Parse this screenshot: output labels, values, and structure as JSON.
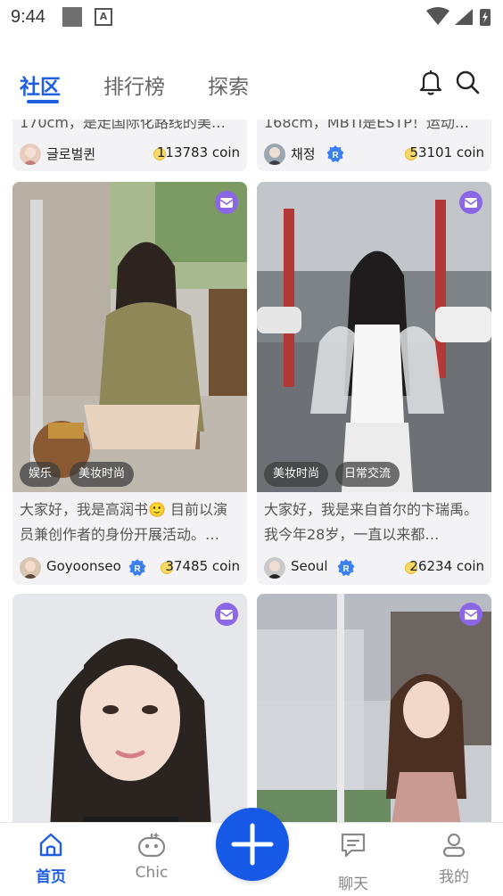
{
  "status_bar": {
    "time": "9:44",
    "notification_letter": "A"
  },
  "header": {
    "tabs": [
      {
        "label": "社区",
        "active": true
      },
      {
        "label": "排行榜",
        "active": false
      },
      {
        "label": "探索",
        "active": false
      }
    ],
    "icons": [
      "bell-icon",
      "search-icon"
    ]
  },
  "feed": {
    "top_partial_cards": [
      {
        "text": "170cm，是走国际化路线的美…",
        "author": "글로벌퀸",
        "verified": false,
        "coins": "113783 coin"
      },
      {
        "text": "168cm，MBTI是ESTP！运动…",
        "author": "채정",
        "verified": true,
        "coins": "53101 coin"
      }
    ],
    "cards": [
      {
        "tags": [
          "娱乐",
          "美妆时尚"
        ],
        "text": "大家好，我是高润书🙂 目前以演员兼创作者的身份开展活动。…",
        "author": "Goyoonseo",
        "verified": true,
        "coins": "37485 coin"
      },
      {
        "tags": [
          "美妆时尚",
          "日常交流"
        ],
        "text": "大家好，我是来自首尔的卞瑞禹。 我今年28岁，一直以来都…",
        "author": "Seoul",
        "verified": true,
        "coins": "26234 coin"
      }
    ]
  },
  "bottom_nav": {
    "items": [
      {
        "label": "首页",
        "icon": "home-icon",
        "active": true
      },
      {
        "label": "Chic",
        "icon": "robot-icon",
        "active": false
      },
      {
        "label": "聊天",
        "icon": "chat-icon",
        "active": false
      },
      {
        "label": "我的",
        "icon": "profile-icon",
        "active": false
      }
    ],
    "fab_icon": "plus-icon"
  },
  "colors": {
    "accent": "#1f5fe0",
    "badge": "#8b67e8",
    "coin": "#f8d867"
  }
}
